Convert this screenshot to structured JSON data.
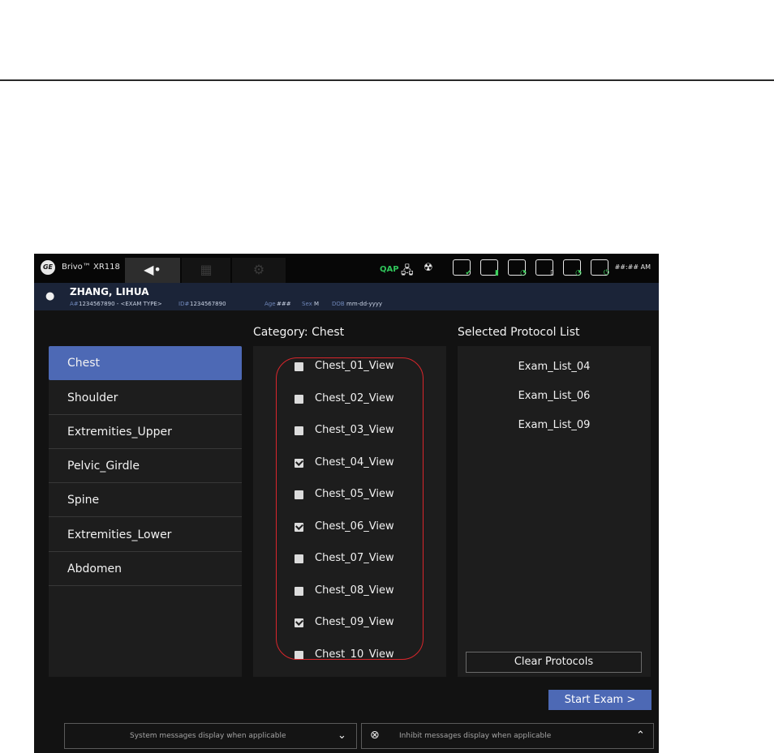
{
  "header": {
    "brand_logo": "GE",
    "product": "Brivo™ XR118",
    "tabs": [
      {
        "icon": "exam-arrow-icon",
        "glyph": "◀•"
      },
      {
        "icon": "image-grid-icon",
        "glyph": "▦"
      },
      {
        "icon": "gear-icon",
        "glyph": "⚙"
      }
    ],
    "qap": "QAP",
    "network_glyph": "🖧",
    "clock": "##:## AM"
  },
  "patient": {
    "name": "ZHANG, LIHUA",
    "accession_label": "A#",
    "accession": "1234567890 - <EXAM TYPE>",
    "id_label": "ID#",
    "id": "1234567890",
    "age_label": "Age",
    "age": "###",
    "sex_label": "Sex",
    "sex": "M",
    "dob_label": "DOB",
    "dob": "mm-dd-yyyy"
  },
  "categories": {
    "items": [
      "Chest",
      "Shoulder",
      "Extremities_Upper",
      "Pelvic_Girdle",
      "Spine",
      "Extremities_Lower",
      "Abdomen"
    ],
    "selected": "Chest"
  },
  "views": {
    "heading": "Category: Chest",
    "items": [
      {
        "label": "Chest_01_View",
        "checked": false
      },
      {
        "label": "Chest_02_View",
        "checked": false
      },
      {
        "label": "Chest_03_View",
        "checked": false
      },
      {
        "label": "Chest_04_View",
        "checked": true
      },
      {
        "label": "Chest_05_View",
        "checked": false
      },
      {
        "label": "Chest_06_View",
        "checked": true
      },
      {
        "label": "Chest_07_View",
        "checked": false
      },
      {
        "label": "Chest_08_View",
        "checked": false
      },
      {
        "label": "Chest_09_View",
        "checked": true
      },
      {
        "label": "Chest_10_View",
        "checked": false
      }
    ]
  },
  "protocols": {
    "heading": "Selected Protocol List",
    "items": [
      "Exam_List_04",
      "Exam_List_06",
      "Exam_List_09"
    ],
    "clear_label": "Clear Protocols"
  },
  "actions": {
    "start_exam": "Start Exam >"
  },
  "messages": {
    "system": "System messages display when applicable",
    "inhibit": "Inhibit messages display when applicable"
  },
  "colors": {
    "accent": "#4d69b5",
    "highlight": "#d9262c",
    "qap": "#2fc45a"
  }
}
